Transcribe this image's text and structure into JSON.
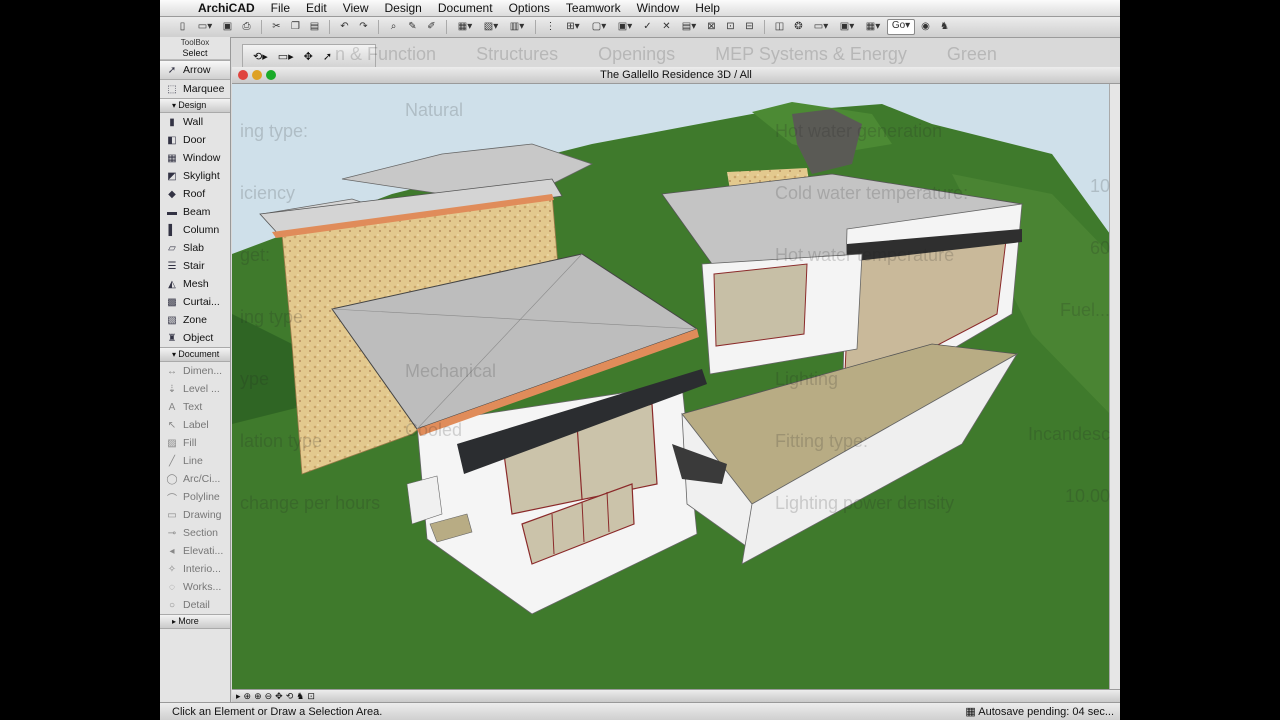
{
  "menubar": {
    "app": "ArchiCAD",
    "items": [
      "File",
      "Edit",
      "View",
      "Design",
      "Document",
      "Options",
      "Teamwork",
      "Window",
      "Help"
    ]
  },
  "toolbar": {
    "go_label": "Go"
  },
  "toolbox": {
    "title": "ToolBox",
    "select_label": "Select",
    "select_tools": [
      {
        "label": "Arrow",
        "icon": "arrow-icon"
      },
      {
        "label": "Marquee",
        "icon": "marquee-icon"
      }
    ],
    "design_label": "Design",
    "design_tools": [
      {
        "label": "Wall",
        "icon": "wall-icon"
      },
      {
        "label": "Door",
        "icon": "door-icon"
      },
      {
        "label": "Window",
        "icon": "window-icon"
      },
      {
        "label": "Skylight",
        "icon": "skylight-icon"
      },
      {
        "label": "Roof",
        "icon": "roof-icon"
      },
      {
        "label": "Beam",
        "icon": "beam-icon"
      },
      {
        "label": "Column",
        "icon": "column-icon"
      },
      {
        "label": "Slab",
        "icon": "slab-icon"
      },
      {
        "label": "Stair",
        "icon": "stair-icon"
      },
      {
        "label": "Mesh",
        "icon": "mesh-icon"
      },
      {
        "label": "Curtai...",
        "icon": "curtain-wall-icon"
      },
      {
        "label": "Zone",
        "icon": "zone-icon"
      },
      {
        "label": "Object",
        "icon": "object-icon"
      }
    ],
    "document_label": "Document",
    "document_tools": [
      {
        "label": "Dimen...",
        "icon": "dimension-icon"
      },
      {
        "label": "Level ...",
        "icon": "level-dimension-icon"
      },
      {
        "label": "Text",
        "icon": "text-icon"
      },
      {
        "label": "Label",
        "icon": "label-icon"
      },
      {
        "label": "Fill",
        "icon": "fill-icon"
      },
      {
        "label": "Line",
        "icon": "line-icon"
      },
      {
        "label": "Arc/Ci...",
        "icon": "arc-icon"
      },
      {
        "label": "Polyline",
        "icon": "polyline-icon"
      },
      {
        "label": "Drawing",
        "icon": "drawing-icon"
      },
      {
        "label": "Section",
        "icon": "section-icon"
      },
      {
        "label": "Elevati...",
        "icon": "elevation-icon"
      },
      {
        "label": "Interio...",
        "icon": "interior-elevation-icon"
      },
      {
        "label": "Works...",
        "icon": "worksheet-icon"
      },
      {
        "label": "Detail",
        "icon": "detail-icon"
      }
    ],
    "more_label": "More"
  },
  "window": {
    "title": "The Gallello Residence 3D / All"
  },
  "status": {
    "left": "Click an Element or Draw a Selection Area.",
    "right": "Autosave pending: 04 sec..."
  },
  "overlay": {
    "tabs": [
      "n & Function",
      "Structures",
      "Openings",
      "MEP Systems & Energy",
      "Green"
    ],
    "left_labels": [
      "ing type:",
      "iciency",
      "get:",
      "ing type",
      "ype",
      "lation type",
      "change per hours"
    ],
    "fields": [
      "Natural",
      "Mechanical",
      "Cooled"
    ],
    "right_labels": [
      "Hot water generation",
      "Cold water temperature:",
      "Hot water temperature",
      "Lighting",
      "Fitting type:",
      "Lighting power density"
    ],
    "right_values": [
      "10",
      "60",
      "Fuel...",
      "Incandesc",
      "10.00"
    ]
  },
  "colors": {
    "grass": "#3f7a2c",
    "wall": "#f4f4f4",
    "roof": "#b7b7b7",
    "stone": "#e3c98e",
    "sky": "#cfe0ea"
  }
}
